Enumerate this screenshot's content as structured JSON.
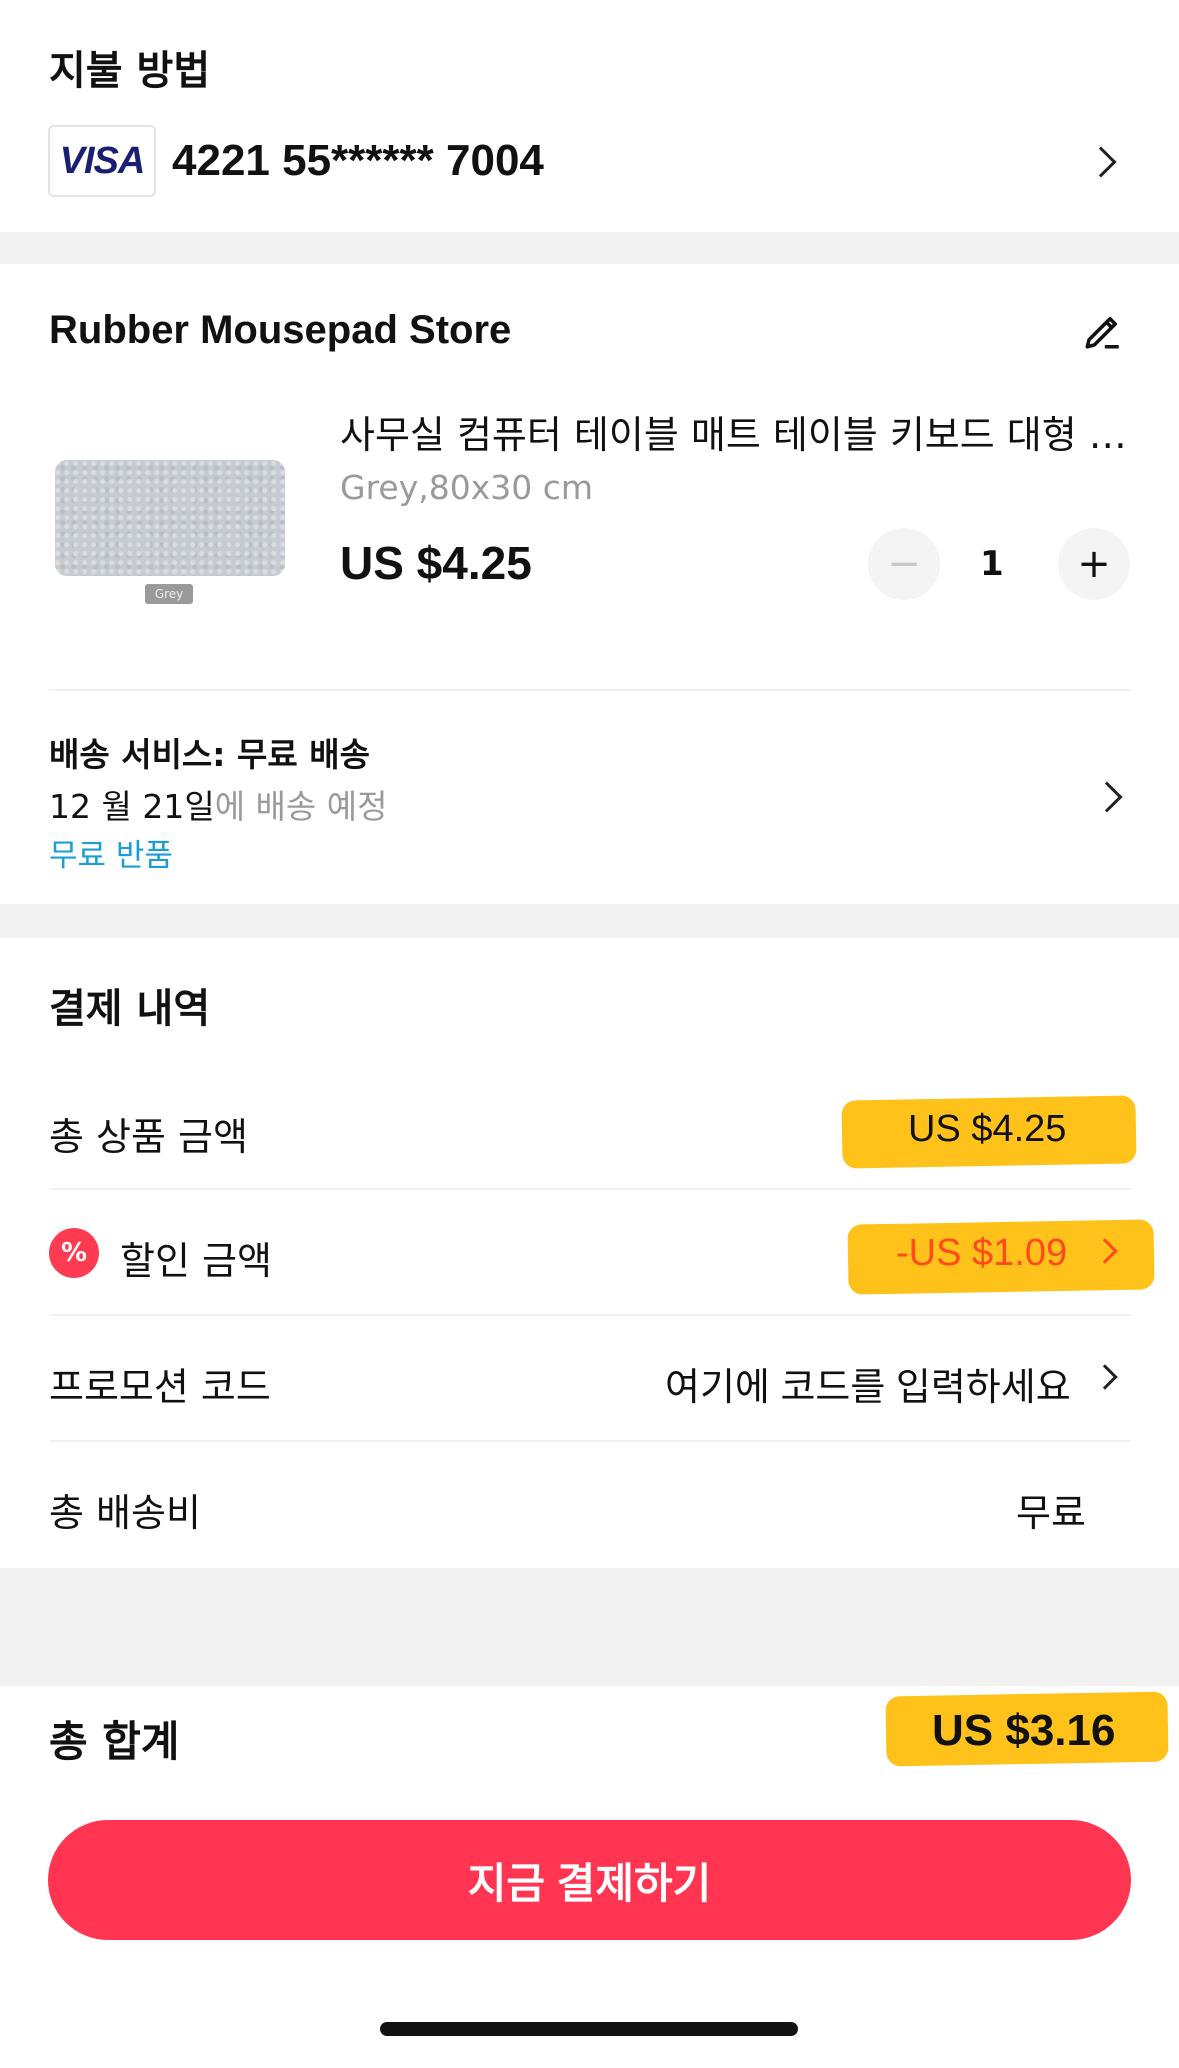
{
  "payment": {
    "title": "지불 방법",
    "card_brand": "VISA",
    "card_number": "4221 55****** 7004"
  },
  "store": {
    "name": "Rubber Mousepad Store",
    "product": {
      "title": "사무실 컴퓨터 테이블 매트 테이블 키보드 대형 마우스 패드",
      "variant": "Grey,80x30 cm",
      "thumb_tag": "Grey",
      "price": "US $4.25",
      "quantity": "1"
    },
    "shipping": {
      "label": "배송 서비스:",
      "method": "무료 배송",
      "date": "12 월 21일",
      "date_suffix": "에 배송 예정",
      "returns": "무료 반품"
    }
  },
  "details": {
    "title": "결제 내역",
    "rows": [
      {
        "label": "총 상품 금액",
        "value": "US $4.25"
      },
      {
        "label": "할인 금액",
        "value": "-US $1.09"
      },
      {
        "label": "프로모션 코드",
        "value": "여기에 코드를 입력하세요"
      },
      {
        "label": "총 배송비",
        "value": "무료"
      }
    ]
  },
  "total": {
    "label": "총 합계",
    "value": "US $3.16",
    "pay_button": "지금 결제하기"
  },
  "colors": {
    "accent": "#ff3552",
    "discount": "#ff4a1c",
    "link": "#1a9ed8",
    "highlight": "#ffc21a"
  }
}
